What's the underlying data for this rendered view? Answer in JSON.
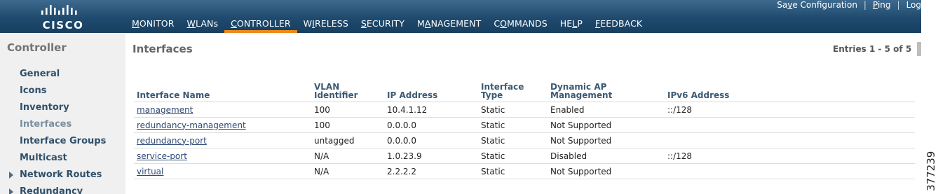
{
  "brand": {
    "logo_text": "CISCO"
  },
  "utility_links": [
    {
      "pre": "Sa",
      "u": "v",
      "post": "e Configuration"
    },
    {
      "pre": "",
      "u": "P",
      "post": "ing"
    },
    {
      "pre": "",
      "u": "",
      "post": "Log"
    }
  ],
  "menu": [
    {
      "u": "M",
      "post": "ONITOR",
      "active": false
    },
    {
      "u": "W",
      "post": "LANs",
      "active": false
    },
    {
      "u": "C",
      "post": "ONTROLLER",
      "active": true
    },
    {
      "pre": "W",
      "u": "I",
      "post": "RELESS",
      "active": false
    },
    {
      "u": "S",
      "post": "ECURITY",
      "active": false
    },
    {
      "pre": "M",
      "u": "A",
      "post": "NAGEMENT",
      "active": false
    },
    {
      "pre": "C",
      "u": "O",
      "post": "MMANDS",
      "active": false
    },
    {
      "pre": "HE",
      "u": "L",
      "post": "P",
      "active": false
    },
    {
      "u": "F",
      "post": "EEDBACK",
      "active": false
    }
  ],
  "sidebar": {
    "title": "Controller",
    "items": [
      {
        "label": "General"
      },
      {
        "label": "Icons"
      },
      {
        "label": "Inventory"
      },
      {
        "label": "Interfaces",
        "active": true
      },
      {
        "label": "Interface Groups"
      },
      {
        "label": "Multicast"
      },
      {
        "label": "Network Routes",
        "expandable": true
      },
      {
        "label": "Redundancy",
        "expandable": true
      }
    ]
  },
  "main": {
    "title": "Interfaces",
    "entries": "Entries 1 - 5 of 5",
    "columns": {
      "name": "Interface Name",
      "vlan_1": "VLAN",
      "vlan_2": "Identifier",
      "ip": "IP Address",
      "type_1": "Interface",
      "type_2": "Type",
      "dap_1": "Dynamic AP",
      "dap_2": "Management",
      "ipv6": "IPv6 Address"
    },
    "rows": [
      {
        "name": "management",
        "vlan": "100",
        "ip": "10.4.1.12",
        "type": "Static",
        "dap": "Enabled",
        "ipv6": "::/128"
      },
      {
        "name": "redundancy-management",
        "vlan": "100",
        "ip": "0.0.0.0",
        "type": "Static",
        "dap": "Not Supported",
        "ipv6": ""
      },
      {
        "name": "redundancy-port",
        "vlan": "untagged",
        "ip": "0.0.0.0",
        "type": "Static",
        "dap": "Not Supported",
        "ipv6": ""
      },
      {
        "name": "service-port",
        "vlan": "N/A",
        "ip": "1.0.23.9",
        "type": "Static",
        "dap": "Disabled",
        "ipv6": "::/128"
      },
      {
        "name": "virtual",
        "vlan": "N/A",
        "ip": "2.2.2.2",
        "type": "Static",
        "dap": "Not Supported",
        "ipv6": ""
      }
    ]
  },
  "figure_id": "377239",
  "colors": {
    "header": "#1f4a6e",
    "active_tab": "#ec8a1c",
    "sidebar_bg": "#f0f0f0",
    "link": "#2d4a74"
  }
}
